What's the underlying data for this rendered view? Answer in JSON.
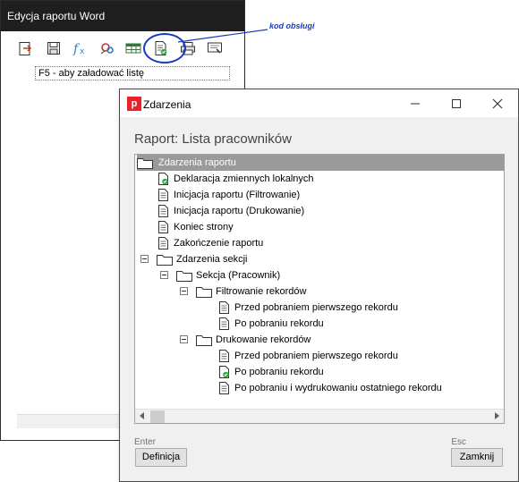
{
  "back_window": {
    "title": "Edycja raportu Word",
    "hint": "F5 - aby załadować listę",
    "toolbar": [
      {
        "icon": "export-icon"
      },
      {
        "icon": "save-icon"
      },
      {
        "icon": "function-icon"
      },
      {
        "icon": "settings-icon"
      },
      {
        "icon": "table-icon"
      },
      {
        "icon": "event-code-icon"
      },
      {
        "icon": "print-icon"
      },
      {
        "icon": "preview-icon"
      }
    ]
  },
  "annotation": {
    "text": "kod obsługi",
    "color": "#1a3cc2"
  },
  "dialog": {
    "title": "Zdarzenia",
    "app_icon_letter": "p",
    "app_icon_color": "#e8232a",
    "heading": "Raport: Lista pracowników",
    "tree": [
      {
        "label": "Zdarzenia raportu",
        "type": "folder",
        "selected": true
      },
      {
        "label": "Deklaracja zmiennych lokalnych",
        "type": "doc-check"
      },
      {
        "label": "Inicjacja raportu (Filtrowanie)",
        "type": "doc"
      },
      {
        "label": "Inicjacja raportu (Drukowanie)",
        "type": "doc"
      },
      {
        "label": "Koniec strony",
        "type": "doc"
      },
      {
        "label": "Zakończenie raportu",
        "type": "doc"
      },
      {
        "label": "Zdarzenia sekcji",
        "type": "folder",
        "expanded": true
      },
      {
        "label": "Sekcja (Pracownik)",
        "type": "folder",
        "expanded": true
      },
      {
        "label": "Filtrowanie rekordów",
        "type": "folder",
        "expanded": true
      },
      {
        "label": "Przed pobraniem pierwszego rekordu",
        "type": "doc"
      },
      {
        "label": "Po pobraniu rekordu",
        "type": "doc"
      },
      {
        "label": "Drukowanie rekordów",
        "type": "folder",
        "expanded": true
      },
      {
        "label": "Przed pobraniem pierwszego rekordu",
        "type": "doc"
      },
      {
        "label": "Po pobraniu rekordu",
        "type": "doc-check"
      },
      {
        "label": "Po pobraniu i wydrukowaniu ostatniego rekordu",
        "type": "doc"
      }
    ],
    "buttons": {
      "definition": {
        "label": "Definicja",
        "key": "Enter"
      },
      "close": {
        "label": "Zamknij",
        "key": "Esc"
      }
    }
  }
}
